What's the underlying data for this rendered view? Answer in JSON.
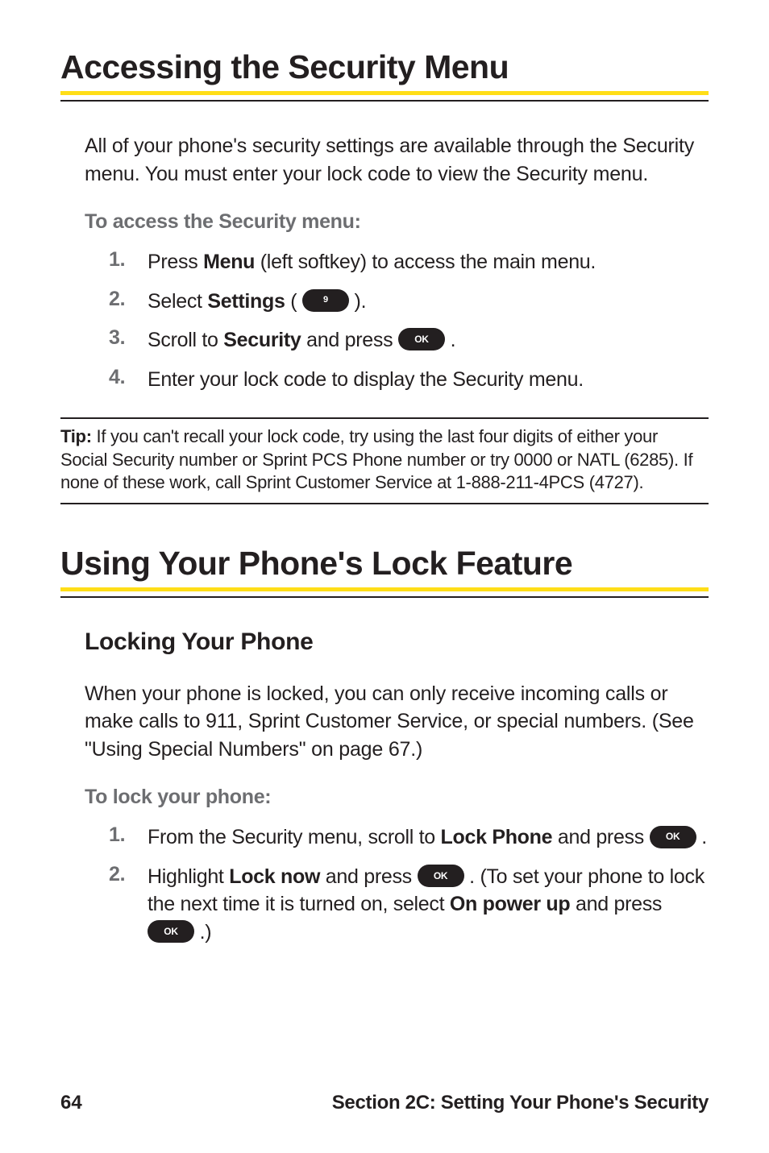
{
  "section1": {
    "title": "Accessing the Security Menu",
    "intro": "All of your phone's security settings are available through the Security menu. You must enter your lock code to view the Security menu.",
    "subhead": "To access the Security menu:",
    "items": [
      {
        "num": "1.",
        "pre": "Press ",
        "bold": "Menu",
        "post": " (left softkey) to access the main menu."
      },
      {
        "num": "2.",
        "pre": "Select ",
        "bold": "Settings",
        "post": " ( ",
        "key": "9",
        "key_class": "key-num",
        "after": " )."
      },
      {
        "num": "3.",
        "pre": "Scroll to ",
        "bold": "Security",
        "post": " and press ",
        "key": "OK",
        "after": " ."
      },
      {
        "num": "4.",
        "text": "Enter your lock code to display the Security menu."
      }
    ],
    "tip": {
      "label": "Tip: ",
      "text": "If you can't recall your lock code, try using the last four digits of either your Social Security number or Sprint PCS Phone number or try 0000 or NATL (6285). If none of these work, call Sprint Customer Service at 1-888-211-4PCS (4727)."
    }
  },
  "section2": {
    "title": "Using Your Phone's Lock Feature",
    "h2": "Locking Your Phone",
    "body": "When your phone is locked, you can only receive incoming calls or make calls to 911, Sprint Customer Service, or special numbers. (See \"Using Special Numbers\" on page 67.)",
    "subhead": "To lock your phone:",
    "items": [
      {
        "num": "1.",
        "parts": [
          {
            "t": "From the Security menu, scroll to "
          },
          {
            "b": "Lock Phone"
          },
          {
            "t": " and press "
          },
          {
            "key": "OK"
          },
          {
            "t": " ."
          }
        ]
      },
      {
        "num": "2.",
        "parts": [
          {
            "t": "Highlight "
          },
          {
            "b": "Lock now"
          },
          {
            "t": " and press "
          },
          {
            "key": "OK"
          },
          {
            "t": " . (To set your phone to lock the next time it is turned on, select "
          },
          {
            "b": "On power up"
          },
          {
            "t": " and press "
          },
          {
            "key": "OK"
          },
          {
            "t": " .)"
          }
        ]
      }
    ]
  },
  "footer": {
    "page": "64",
    "text": "Section 2C: Setting Your Phone's Security"
  }
}
